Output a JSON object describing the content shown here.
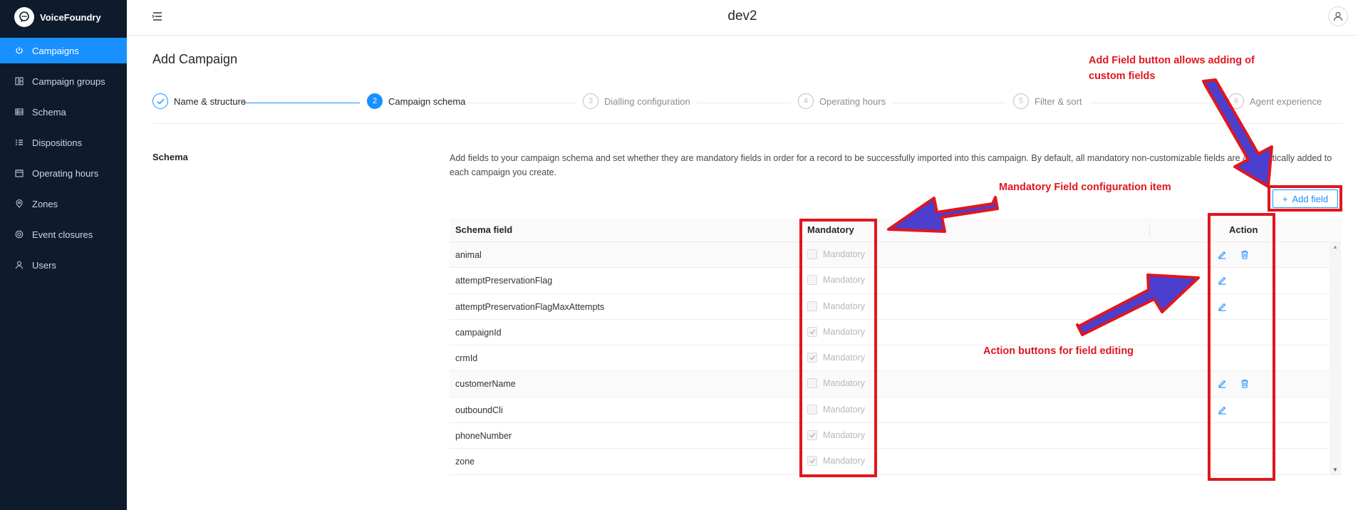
{
  "app": {
    "brand": "VoiceFoundry",
    "environment": "dev2"
  },
  "sidebar": {
    "items": [
      {
        "label": "Campaigns",
        "icon": "power-icon",
        "active": true
      },
      {
        "label": "Campaign groups",
        "icon": "grid-icon",
        "active": false
      },
      {
        "label": "Schema",
        "icon": "table-icon",
        "active": false
      },
      {
        "label": "Dispositions",
        "icon": "list-icon",
        "active": false
      },
      {
        "label": "Operating hours",
        "icon": "calendar-icon",
        "active": false
      },
      {
        "label": "Zones",
        "icon": "location-icon",
        "active": false
      },
      {
        "label": "Event closures",
        "icon": "target-icon",
        "active": false
      },
      {
        "label": "Users",
        "icon": "user-icon",
        "active": false
      }
    ]
  },
  "page": {
    "title": "Add Campaign",
    "steps": [
      {
        "number": "1",
        "label": "Name & structure",
        "status": "done"
      },
      {
        "number": "2",
        "label": "Campaign schema",
        "status": "current"
      },
      {
        "number": "3",
        "label": "Dialling configuration",
        "status": "pending"
      },
      {
        "number": "4",
        "label": "Operating hours",
        "status": "pending"
      },
      {
        "number": "5",
        "label": "Filter & sort",
        "status": "pending"
      },
      {
        "number": "6",
        "label": "Agent experience",
        "status": "pending"
      }
    ],
    "section_label": "Schema",
    "description": "Add fields to your campaign schema and set whether they are mandatory fields in order for a record to be successfully imported into this campaign. By default, all mandatory non-customizable fields are automatically added to each campaign you create.",
    "add_field_label": "Add field"
  },
  "table": {
    "headers": {
      "field": "Schema field",
      "mandatory": "Mandatory",
      "action": "Action"
    },
    "mandatory_text": "Mandatory",
    "rows": [
      {
        "field": "animal",
        "checked": false,
        "edit": true,
        "delete": true
      },
      {
        "field": "attemptPreservationFlag",
        "checked": false,
        "edit": true,
        "delete": false
      },
      {
        "field": "attemptPreservationFlagMaxAttempts",
        "checked": false,
        "edit": true,
        "delete": false
      },
      {
        "field": "campaignId",
        "checked": true,
        "edit": false,
        "delete": false
      },
      {
        "field": "crmId",
        "checked": true,
        "edit": false,
        "delete": false
      },
      {
        "field": "customerName",
        "checked": false,
        "edit": true,
        "delete": true
      },
      {
        "field": "outboundCli",
        "checked": false,
        "edit": true,
        "delete": false
      },
      {
        "field": "phoneNumber",
        "checked": true,
        "edit": false,
        "delete": false
      },
      {
        "field": "zone",
        "checked": true,
        "edit": false,
        "delete": false
      }
    ]
  },
  "annotations": {
    "add_field_note": "Add Field button allows adding of custom fields",
    "mandatory_note": "Mandatory Field configuration item",
    "action_note": "Action buttons for field editing"
  },
  "colors": {
    "sidebar_bg": "#0e1b2d",
    "accent": "#1890ff",
    "annotation": "#e0161e",
    "arrow": "#4a3fcf"
  }
}
